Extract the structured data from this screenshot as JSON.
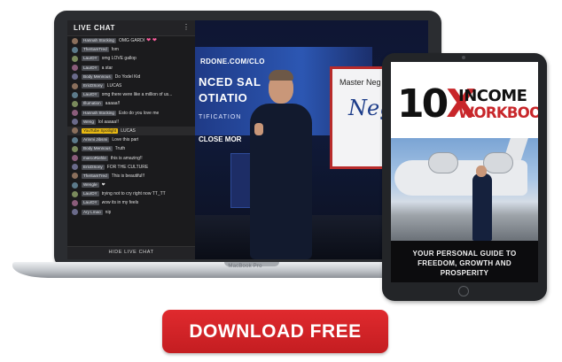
{
  "laptop": {
    "model_label": "MacBook Pro"
  },
  "chat": {
    "title": "LIVE CHAT",
    "menu_icon": "more-vertical-icon",
    "hide_label": "HIDE LIVE CHAT",
    "messages": [
      {
        "name": "Hannah Stocking",
        "text": "OMG GARDI",
        "hearts": "❤ ❤"
      },
      {
        "name": "TheSamTred",
        "text": "fom"
      },
      {
        "name": "LaurDY",
        "text": "omg LOVE gallop"
      },
      {
        "name": "LaurDY",
        "text": "a star"
      },
      {
        "name": "Body Mennous",
        "text": "Do Yodel Kid"
      },
      {
        "name": "EricDSony",
        "text": "LUCAS"
      },
      {
        "name": "LaurDY",
        "text": "omg there were like a million of us..."
      },
      {
        "name": "Illumation",
        "text": "aaaaa!!"
      },
      {
        "name": "Hannah Stocking",
        "text": "Esto do you love me"
      },
      {
        "name": "Weng",
        "text": "lol aaaaa!!"
      },
      {
        "name": "YouTube Spotlight",
        "text": "LUCAS",
        "highlight": true
      },
      {
        "name": "Arinmi Jibsmi",
        "text": "Love this part"
      },
      {
        "name": "Body Mennous",
        "text": "Truth"
      },
      {
        "name": "marcoRiehle",
        "text": "this is amazing!!"
      },
      {
        "name": "EricDSony",
        "text": "FOR THE CULTURE"
      },
      {
        "name": "TheSamTred",
        "text": "This is beautiful!!"
      },
      {
        "name": "Wengle",
        "text": "❤"
      },
      {
        "name": "LaurDY",
        "text": "trying not to cry right now TT_TT"
      },
      {
        "name": "LaurDY",
        "text": "wow its in my feels"
      },
      {
        "name": "Ary Lmao",
        "text": "nip"
      }
    ]
  },
  "video": {
    "url_text": "RDONE.COM/CLO",
    "slide_line1": "NCED SAL",
    "slide_line2": "OTIATIO",
    "slide_sub": "TIFICATION",
    "slide_bottom": "CLOSE MOR",
    "whiteboard_title": "Master Neg",
    "whiteboard_scrawl": "Neg"
  },
  "book": {
    "title_10": "10",
    "title_x": "X",
    "title_income": "INCOME",
    "title_workbook": "WORKBOOK",
    "subtitle": "YOUR PERSONAL GUIDE TO FREEDOM, GROWTH AND PROSPERITY"
  },
  "cta": {
    "label": "DOWNLOAD FREE"
  },
  "colors": {
    "accent_red": "#c8262a",
    "button_red": "#d42428",
    "chat_bg": "#1b1b1d",
    "highlight_badge": "#e8b913"
  }
}
